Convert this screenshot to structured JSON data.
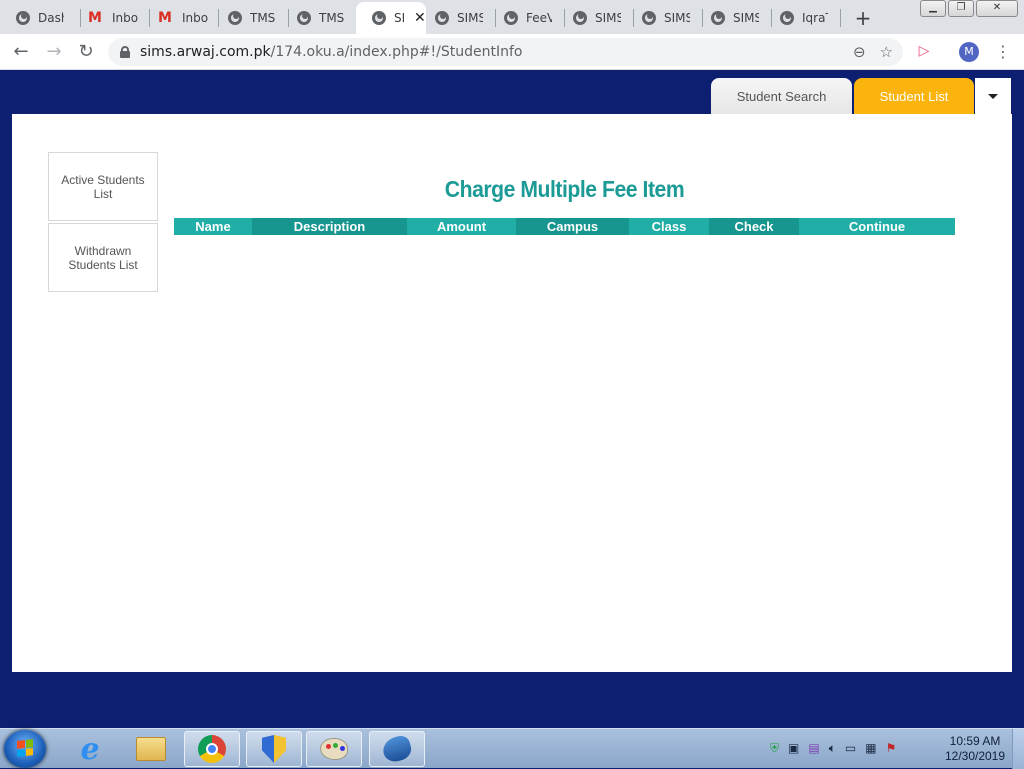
{
  "browser": {
    "tabs": [
      {
        "title": "Dashb",
        "icon": "globe-icon",
        "active": false
      },
      {
        "title": "Inbox",
        "icon": "gmail-icon",
        "active": false
      },
      {
        "title": "Inbox",
        "icon": "gmail-icon",
        "active": false
      },
      {
        "title": "TMS",
        "icon": "globe-icon",
        "active": false
      },
      {
        "title": "TMS",
        "icon": "globe-icon",
        "active": false
      },
      {
        "title": "SI",
        "icon": "globe-icon",
        "active": true
      },
      {
        "title": "SIMS",
        "icon": "globe-icon",
        "active": false
      },
      {
        "title": "FeeV",
        "icon": "globe-icon",
        "active": false
      },
      {
        "title": "SIMS",
        "icon": "globe-icon",
        "active": false
      },
      {
        "title": "SIMS",
        "icon": "globe-icon",
        "active": false
      },
      {
        "title": "SIMS",
        "icon": "globe-icon",
        "active": false
      },
      {
        "title": "IqraT",
        "icon": "globe-icon",
        "active": false
      }
    ],
    "new_tab_label": "+",
    "url_host": "sims.arwaj.com.pk",
    "url_path": "/174.oku.a/index.php#!/StudentInfo",
    "profile_initial": "M"
  },
  "page": {
    "nav": {
      "student_search": "Student Search",
      "student_list": "Student List"
    },
    "sidebar": {
      "items": [
        {
          "label": "Active Students List"
        },
        {
          "label": "Withdrawn Students List"
        }
      ]
    },
    "heading": "Charge Multiple Fee Item",
    "table": {
      "columns": [
        "Name",
        "Description",
        "Amount",
        "Campus",
        "Class",
        "Check",
        "Continue"
      ]
    }
  },
  "taskbar": {
    "time": "10:59 AM",
    "date": "12/30/2019"
  },
  "colors": {
    "page_bg": "#0d1f70",
    "accent_teal": "#1b9a96",
    "tab_active_yellow": "#fbb40d"
  }
}
